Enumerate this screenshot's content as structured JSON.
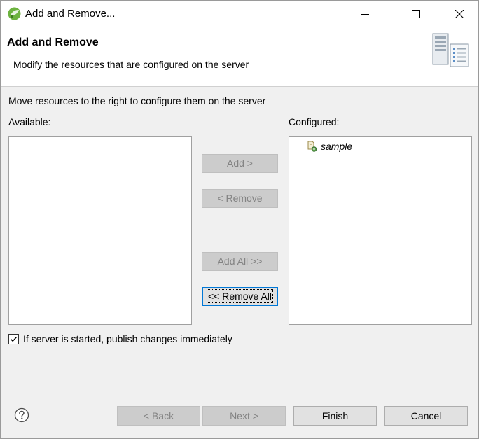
{
  "window": {
    "title": "Add and Remove...",
    "icon": "eclipse-spring-icon"
  },
  "banner": {
    "title": "Add and Remove",
    "description": "Modify the resources that are configured on the server",
    "graphic": "server-wizard-graphic"
  },
  "body": {
    "instructions": "Move resources to the right to configure them on the server",
    "available_label": "Available:",
    "configured_label": "Configured:",
    "available_items": [],
    "configured_items": [
      {
        "label": "sample",
        "icon": "web-module-icon"
      }
    ]
  },
  "buttons": {
    "add": "Add >",
    "remove": "< Remove",
    "add_all": "Add All >>",
    "remove_all": "<< Remove All"
  },
  "publish_checkbox": {
    "label": "If server is started, publish changes immediately",
    "checked": true
  },
  "footer": {
    "back": "< Back",
    "next": "Next >",
    "finish": "Finish",
    "cancel": "Cancel"
  }
}
